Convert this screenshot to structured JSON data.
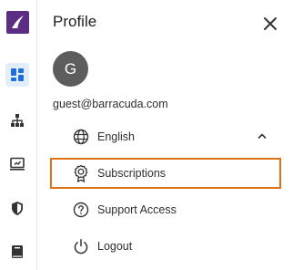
{
  "rail": {
    "icons": [
      {
        "name": "dashboard-icon",
        "active": true
      },
      {
        "name": "network-icon",
        "active": false
      },
      {
        "name": "monitor-icon",
        "active": false
      },
      {
        "name": "shield-icon",
        "active": false
      },
      {
        "name": "book-icon",
        "active": false
      }
    ],
    "accent_color": "#1f6fd6",
    "logo_color": "#5b2d83"
  },
  "profile": {
    "title": "Profile",
    "avatar_initial": "G",
    "email": "guest@barracuda.com"
  },
  "menu": {
    "language_label": "English",
    "subscriptions_label": "Subscriptions",
    "support_access_label": "Support Access",
    "logout_label": "Logout"
  },
  "colors": {
    "highlight_border": "#e07318",
    "avatar_bg": "#5d5d5d"
  }
}
